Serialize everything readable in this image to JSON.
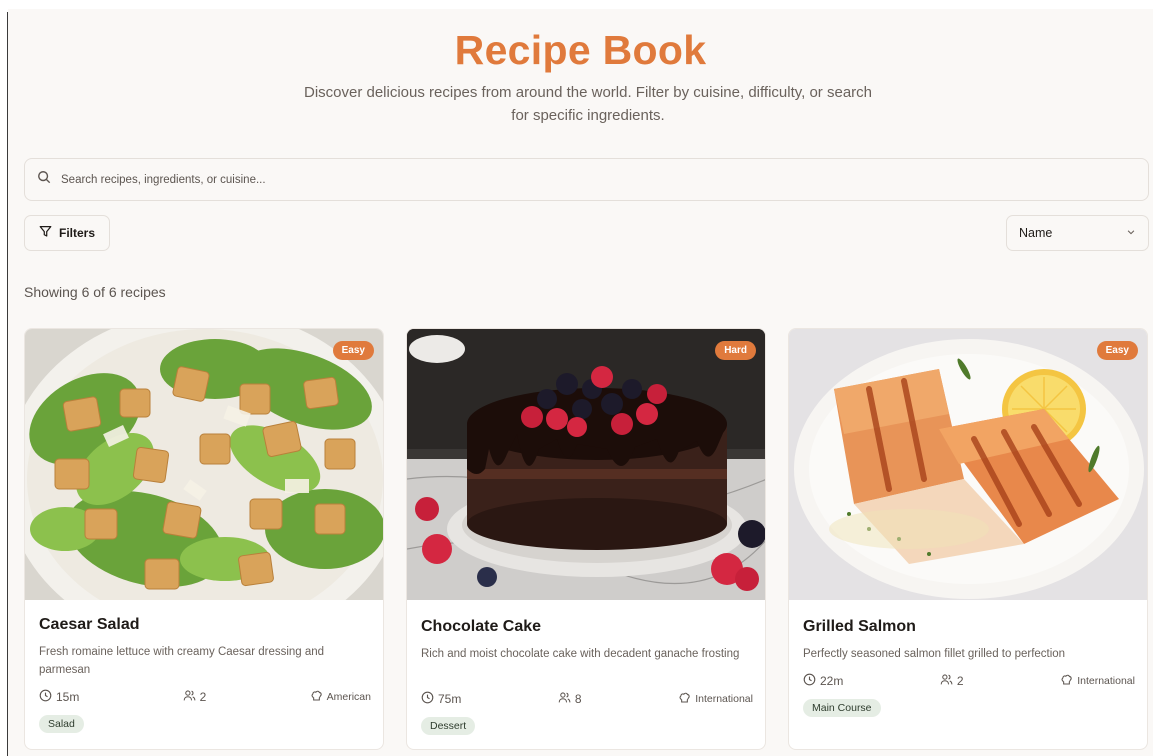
{
  "header": {
    "title": "Recipe Book",
    "subtitle": "Discover delicious recipes from around the world. Filter by cuisine, difficulty, or search for specific ingredients."
  },
  "search": {
    "placeholder": "Search recipes, ingredients, or cuisine..."
  },
  "toolbar": {
    "filters_label": "Filters",
    "sort_value": "Name"
  },
  "results": {
    "count_text": "Showing 6 of 6 recipes"
  },
  "colors": {
    "accent": "#e07a3c",
    "tag_bg": "#e5ede4",
    "page_bg": "#faf8f6"
  },
  "recipes": [
    {
      "title": "Caesar Salad",
      "difficulty": "Easy",
      "description": "Fresh romaine lettuce with creamy Caesar dressing and parmesan",
      "time": "15m",
      "servings": "2",
      "cuisine": "American",
      "category": "Salad"
    },
    {
      "title": "Chocolate Cake",
      "difficulty": "Hard",
      "description": "Rich and moist chocolate cake with decadent ganache frosting",
      "time": "75m",
      "servings": "8",
      "cuisine": "International",
      "category": "Dessert"
    },
    {
      "title": "Grilled Salmon",
      "difficulty": "Easy",
      "description": "Perfectly seasoned salmon fillet grilled to perfection",
      "time": "22m",
      "servings": "2",
      "cuisine": "International",
      "category": "Main Course"
    }
  ]
}
